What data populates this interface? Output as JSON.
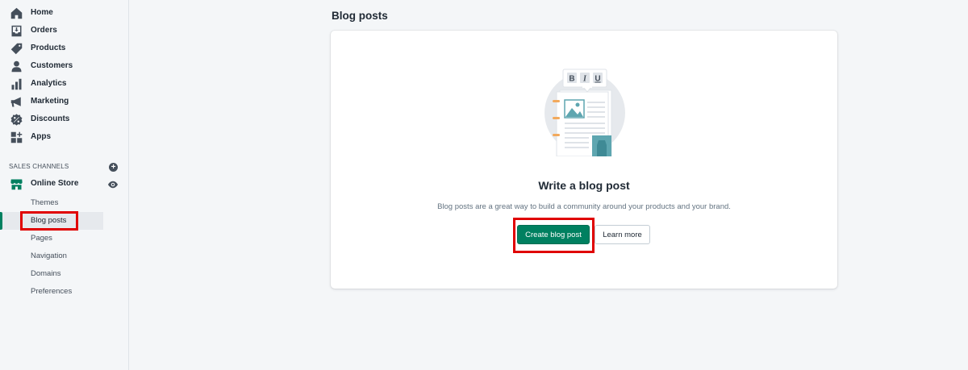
{
  "sidebar": {
    "items": [
      {
        "label": "Home",
        "icon": "home-icon"
      },
      {
        "label": "Orders",
        "icon": "orders-icon"
      },
      {
        "label": "Products",
        "icon": "tag-icon"
      },
      {
        "label": "Customers",
        "icon": "person-icon"
      },
      {
        "label": "Analytics",
        "icon": "bar-chart-icon"
      },
      {
        "label": "Marketing",
        "icon": "megaphone-icon"
      },
      {
        "label": "Discounts",
        "icon": "discount-icon"
      },
      {
        "label": "Apps",
        "icon": "apps-icon"
      }
    ],
    "sales_channels_label": "SALES CHANNELS",
    "online_store": {
      "label": "Online Store",
      "icon": "store-icon"
    },
    "sub_items": [
      {
        "label": "Themes"
      },
      {
        "label": "Blog posts",
        "active": true
      },
      {
        "label": "Pages"
      },
      {
        "label": "Navigation"
      },
      {
        "label": "Domains"
      },
      {
        "label": "Preferences"
      }
    ]
  },
  "main": {
    "page_title": "Blog posts",
    "empty_state": {
      "heading": "Write a blog post",
      "description": "Blog posts are a great way to build a community around your products and your brand.",
      "primary_button": "Create blog post",
      "secondary_button": "Learn more",
      "toolbar": [
        "B",
        "I",
        "U"
      ]
    }
  },
  "colors": {
    "accent": "#008060",
    "highlight": "#e00000",
    "illustration_teal": "#5ea6b0",
    "illustration_orange": "#f2a95c"
  }
}
